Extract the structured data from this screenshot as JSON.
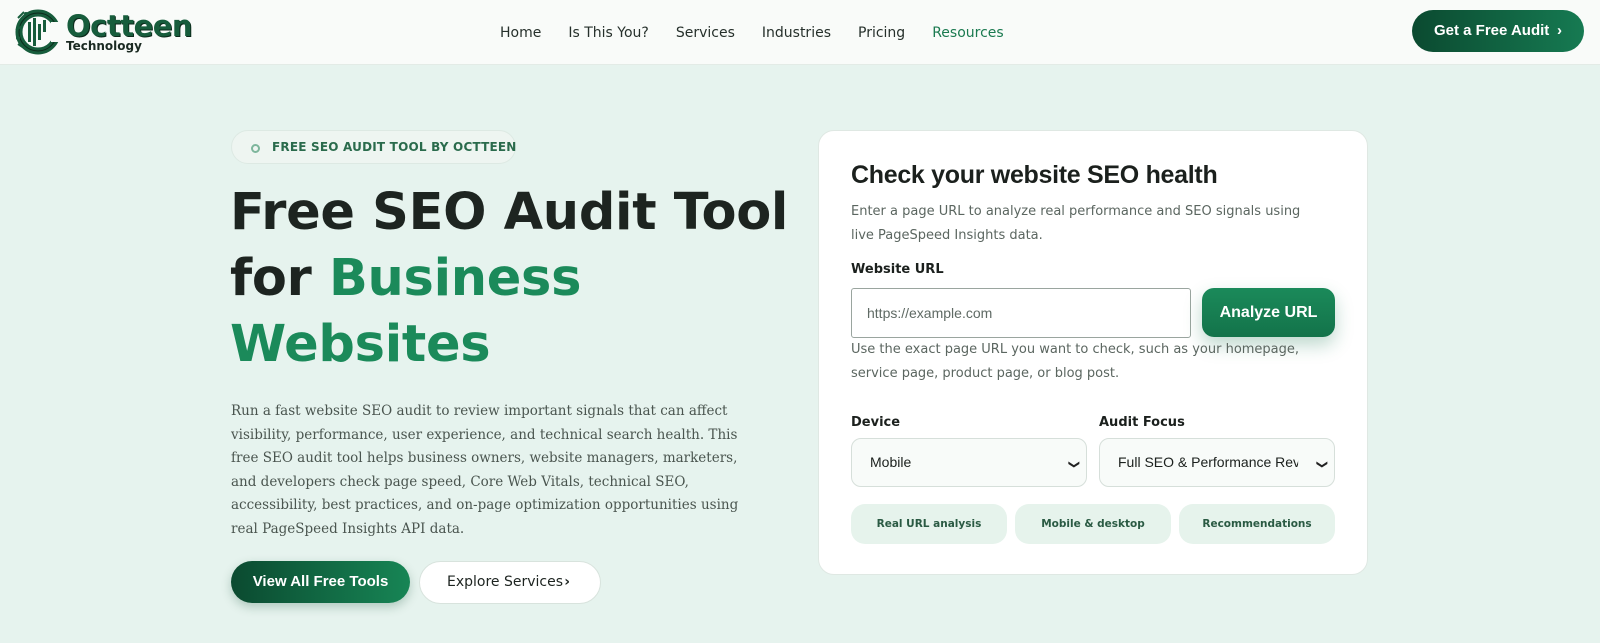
{
  "brand": {
    "name": "Octteen",
    "sub": "Technology",
    "primary": "#175d3c",
    "accent": "#1b8a5a"
  },
  "nav": {
    "links": [
      {
        "label": "Home"
      },
      {
        "label": "Is This You?"
      },
      {
        "label": "Services"
      },
      {
        "label": "Industries"
      },
      {
        "label": "Pricing"
      },
      {
        "label": "Resources",
        "active": true
      }
    ],
    "cta": {
      "label": "Get a Free Audit",
      "icon": "chevron-right-icon"
    }
  },
  "hero": {
    "badge": "FREE SEO AUDIT TOOL BY OCTTEEN",
    "title_line1": "Free SEO Audit Tool",
    "title_for": "for ",
    "title_green1": "Business",
    "title_green2": "Websites",
    "description": "Run a fast website SEO audit to review important signals that can affect visibility, performance, user experience, and technical search health. This free SEO audit tool helps business owners, website managers, marketers, and developers check page speed, Core Web Vitals, technical SEO, accessibility, best practices, and on-page optimization opportunities using real PageSpeed Insights API data.",
    "primary_button": "View All Free Tools",
    "secondary_button": "Explore Services"
  },
  "card": {
    "title": "Check your website SEO health",
    "subtitle": "Enter a page URL to analyze real performance and SEO signals using live PageSpeed Insights data.",
    "url_label": "Website URL",
    "url_placeholder": "https://example.com",
    "url_value": "",
    "analyze_button": "Analyze URL",
    "hint": "Use the exact page URL you want to check, such as your homepage, service page, product page, or blog post.",
    "device_label": "Device",
    "device_value": "Mobile",
    "focus_label": "Audit Focus",
    "focus_value": "Full SEO & Performance Review",
    "pills": [
      "Real URL analysis",
      "Mobile & desktop",
      "Recommendations"
    ]
  }
}
